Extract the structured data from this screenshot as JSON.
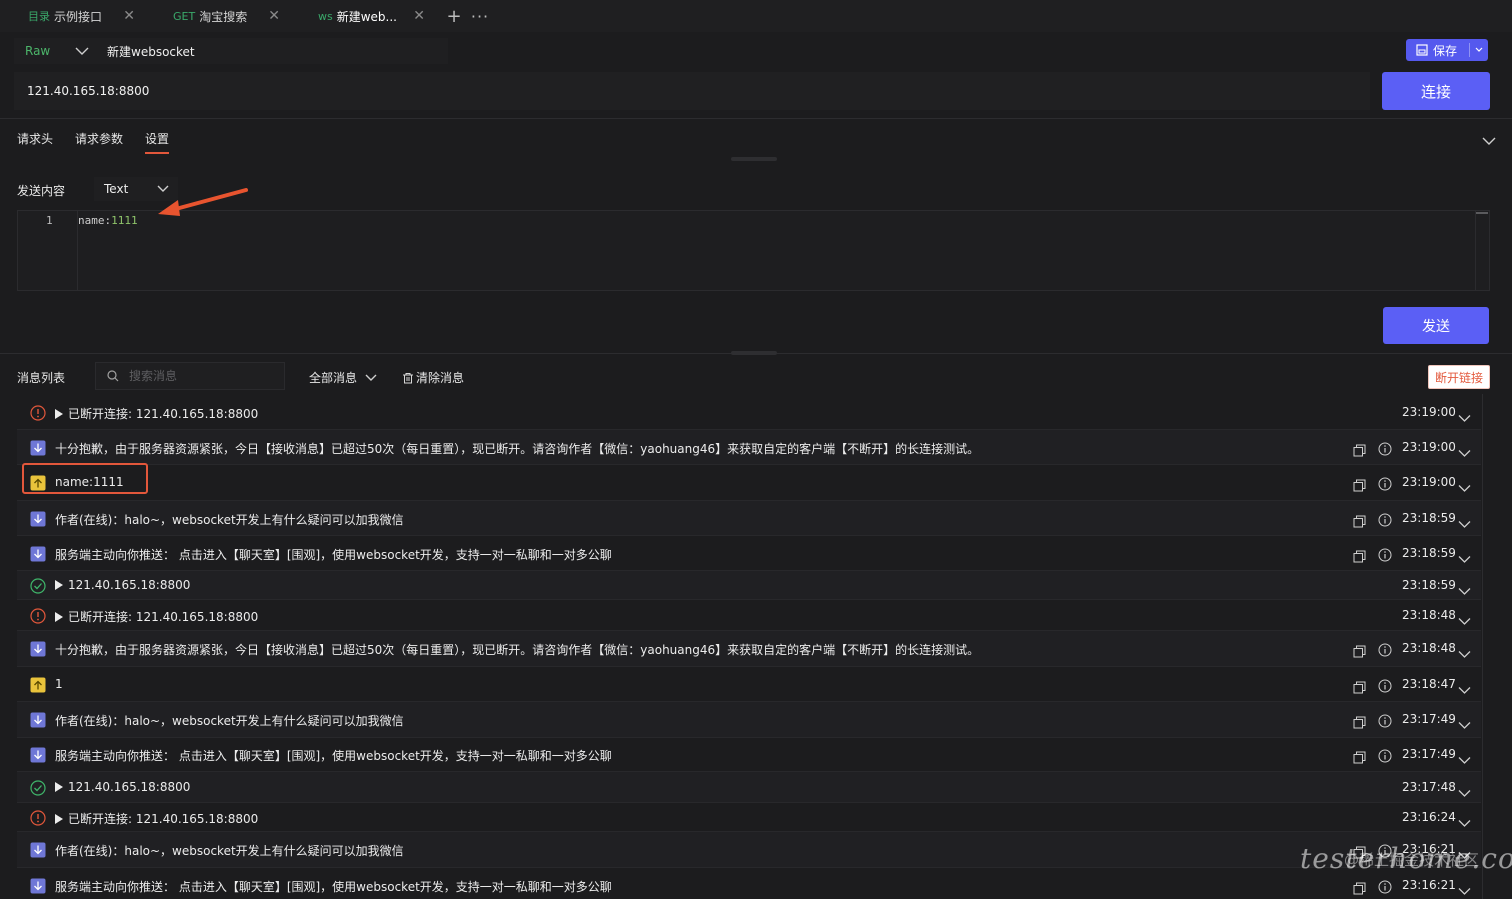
{
  "tabs": [
    {
      "kind": "目录",
      "label": "示例接口",
      "kind_color": "#3aa86a"
    },
    {
      "kind": "GET",
      "label": "淘宝搜索",
      "kind_color": "#3aa86a"
    },
    {
      "kind": "ws",
      "label": "新建web...",
      "kind_color": "#3aa86a"
    }
  ],
  "tab_add": "+",
  "tab_more": "···",
  "request": {
    "mode": "Raw",
    "name": "新建websocket",
    "save_label": "保存",
    "url": "121.40.165.18:8800",
    "connect_label": "连接"
  },
  "subtabs": [
    "请求头",
    "请求参数",
    "设置"
  ],
  "send": {
    "label": "发送内容",
    "format": "Text",
    "line_number": "1",
    "code_key": "name:",
    "code_value": "1111",
    "send_label": "发送"
  },
  "messages_toolbar": {
    "title": "消息列表",
    "search_placeholder": "搜索消息",
    "filter": "全部消息",
    "clear": "清除消息",
    "disconnect": "断开链接"
  },
  "messages": [
    {
      "type": "error",
      "text": "已断开连接: 121.40.165.18:8800",
      "time": "23:19:00",
      "expandable": true
    },
    {
      "type": "received",
      "text": "十分抱歉，由于服务器资源紧张，今日【接收消息】已超过50次（每日重置），现已断开。请咨询作者【微信：yaohuang46】来获取自定的客户端【不断开】的长连接测试。",
      "time": "23:19:00"
    },
    {
      "type": "sent",
      "text": "name:1111",
      "time": "23:19:00"
    },
    {
      "type": "received",
      "text": "作者(在线)：halo~，websocket开发上有什么疑问可以加我微信",
      "time": "23:18:59"
    },
    {
      "type": "received",
      "text": "服务端主动向你推送： 点击进入【聊天室】[围观]，使用websocket开发，支持一对一私聊和一对多公聊",
      "time": "23:18:59"
    },
    {
      "type": "success",
      "text": "121.40.165.18:8800",
      "time": "23:18:59",
      "expandable": true
    },
    {
      "type": "error",
      "text": "已断开连接: 121.40.165.18:8800",
      "time": "23:18:48",
      "expandable": true
    },
    {
      "type": "received",
      "text": "十分抱歉，由于服务器资源紧张，今日【接收消息】已超过50次（每日重置），现已断开。请咨询作者【微信：yaohuang46】来获取自定的客户端【不断开】的长连接测试。",
      "time": "23:18:48"
    },
    {
      "type": "sent",
      "text": "1",
      "time": "23:18:47"
    },
    {
      "type": "received",
      "text": "作者(在线)：halo~，websocket开发上有什么疑问可以加我微信",
      "time": "23:17:49"
    },
    {
      "type": "received",
      "text": "服务端主动向你推送： 点击进入【聊天室】[围观]，使用websocket开发，支持一对一私聊和一对多公聊",
      "time": "23:17:49"
    },
    {
      "type": "success",
      "text": "121.40.165.18:8800",
      "time": "23:17:48",
      "expandable": true
    },
    {
      "type": "error",
      "text": "已断开连接: 121.40.165.18:8800",
      "time": "23:16:24",
      "expandable": true
    },
    {
      "type": "received",
      "text": "作者(在线)：halo~，websocket开发上有什么疑问可以加我微信",
      "time": "23:16:21"
    },
    {
      "type": "received",
      "text": "服务端主动向你推送： 点击进入【聊天室】[围观]，使用websocket开发，支持一对一私聊和一对多公聊",
      "time": "23:16:21"
    }
  ],
  "colors": {
    "accent": "#5b5ff5",
    "error": "#e2573b",
    "success": "#3fb56a",
    "received": "#6f77d6",
    "sent": "#e9c33b"
  },
  "watermark": {
    "text": "testerhome.com",
    "community": "@稀土掘金技术社区"
  }
}
